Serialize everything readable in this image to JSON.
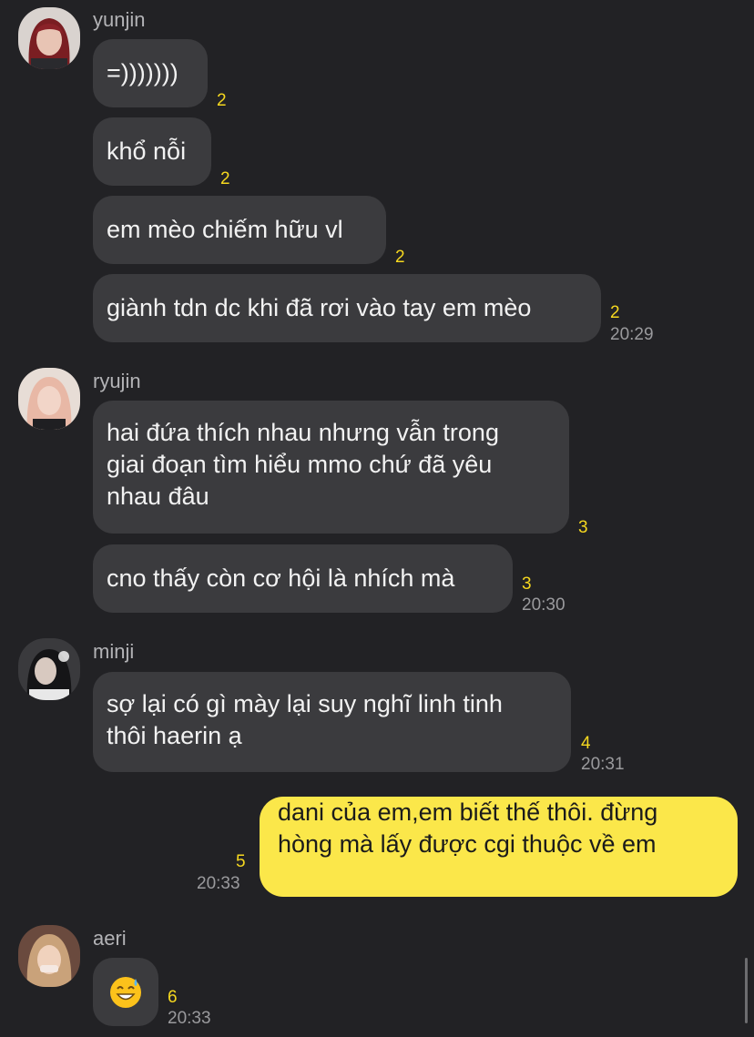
{
  "groups": [
    {
      "sender": "yunjin",
      "messages": [
        {
          "text": "=)))))))",
          "unread": "2"
        },
        {
          "text": "khổ nỗi",
          "unread": "2"
        },
        {
          "text": "em mèo chiếm hữu vl",
          "unread": "2"
        },
        {
          "text": "giành tdn dc khi đã rơi vào tay em mèo",
          "unread": "2",
          "time": "20:29"
        }
      ]
    },
    {
      "sender": "ryujin",
      "messages": [
        {
          "text": "hai đứa thích nhau nhưng vẫn trong\ngiai đoạn tìm hiểu mmo chứ đã yêu\nnhau đâu",
          "unread": "3"
        },
        {
          "text": "cno thấy còn cơ hội là nhích mà",
          "unread": "3",
          "time": "20:30"
        }
      ]
    },
    {
      "sender": "minji",
      "messages": [
        {
          "text": "sợ lại có gì mày lại suy nghĩ linh tinh\nthôi haerin ạ",
          "unread": "4",
          "time": "20:31"
        }
      ]
    },
    {
      "sender": "me",
      "messages": [
        {
          "text": "dani của em,em biết thế thôi. đừng\nhòng mà lấy được cgi thuộc về em",
          "unread": "5",
          "time": "20:33"
        }
      ]
    },
    {
      "sender": "aeri",
      "messages": [
        {
          "emoji": "grinning-sweat-emoji",
          "unread": "6",
          "time": "20:33"
        }
      ]
    }
  ],
  "colors": {
    "background": "#222225",
    "bubble_other": "#3b3b3e",
    "bubble_me": "#fbe74a",
    "unread": "#f6d81f",
    "time": "#9a9a9d"
  }
}
